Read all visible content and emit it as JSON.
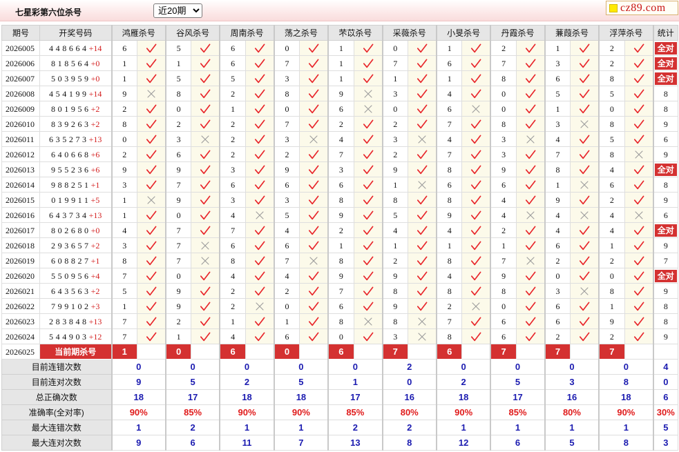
{
  "header": {
    "title": "七星彩第六位杀号",
    "period_selected": "近20期",
    "logo_text": "cz89.com"
  },
  "colors": {
    "accent_red": "#d43131",
    "check_red": "#e8262b",
    "cross_gray": "#9c9c9c",
    "value_blue": "#1b1bb0",
    "header_gray": "#e6e6e6"
  },
  "table": {
    "columns": {
      "issue": "期号",
      "draw": "开奖号码",
      "killers": [
        "鸿雁杀号",
        "谷风杀号",
        "周南杀号",
        "荡之杀号",
        "芣苡杀号",
        "采薇杀号",
        "小旻杀号",
        "丹霞杀号",
        "蒹葭杀号",
        "浮萍杀号"
      ],
      "stat": "统计"
    },
    "rows": [
      {
        "issue": "2026005",
        "draw": "448664",
        "extra": "+14",
        "kills": [
          6,
          5,
          6,
          0,
          1,
          0,
          1,
          2,
          1,
          2
        ],
        "hits": [
          true,
          true,
          true,
          true,
          true,
          true,
          true,
          true,
          true,
          true
        ],
        "stat": "全对"
      },
      {
        "issue": "2026006",
        "draw": "818564",
        "extra": "+0",
        "kills": [
          1,
          1,
          6,
          7,
          1,
          7,
          6,
          7,
          3,
          2
        ],
        "hits": [
          true,
          true,
          true,
          true,
          true,
          true,
          true,
          true,
          true,
          true
        ],
        "stat": "全对"
      },
      {
        "issue": "2026007",
        "draw": "503959",
        "extra": "+0",
        "kills": [
          1,
          5,
          5,
          3,
          1,
          1,
          1,
          8,
          6,
          8
        ],
        "hits": [
          true,
          true,
          true,
          true,
          true,
          true,
          true,
          true,
          true,
          true
        ],
        "stat": "全对"
      },
      {
        "issue": "2026008",
        "draw": "454199",
        "extra": "+14",
        "kills": [
          9,
          8,
          2,
          8,
          9,
          3,
          4,
          0,
          5,
          5
        ],
        "hits": [
          false,
          true,
          true,
          true,
          false,
          true,
          true,
          true,
          true,
          true
        ],
        "stat": "8"
      },
      {
        "issue": "2026009",
        "draw": "801956",
        "extra": "+2",
        "kills": [
          2,
          0,
          1,
          0,
          6,
          0,
          6,
          0,
          1,
          0
        ],
        "hits": [
          true,
          true,
          true,
          true,
          false,
          true,
          false,
          true,
          true,
          true
        ],
        "stat": "8"
      },
      {
        "issue": "2026010",
        "draw": "839263",
        "extra": "+2",
        "kills": [
          8,
          2,
          2,
          7,
          2,
          2,
          7,
          8,
          3,
          8
        ],
        "hits": [
          true,
          true,
          true,
          true,
          true,
          true,
          true,
          true,
          false,
          true
        ],
        "stat": "9"
      },
      {
        "issue": "2026011",
        "draw": "635273",
        "extra": "+13",
        "kills": [
          0,
          3,
          2,
          3,
          4,
          3,
          4,
          3,
          4,
          5
        ],
        "hits": [
          true,
          false,
          true,
          false,
          true,
          false,
          true,
          false,
          true,
          true
        ],
        "stat": "6"
      },
      {
        "issue": "2026012",
        "draw": "640668",
        "extra": "+6",
        "kills": [
          2,
          6,
          2,
          2,
          7,
          2,
          7,
          3,
          7,
          8
        ],
        "hits": [
          true,
          true,
          true,
          true,
          true,
          true,
          true,
          true,
          true,
          false
        ],
        "stat": "9"
      },
      {
        "issue": "2026013",
        "draw": "955236",
        "extra": "+6",
        "kills": [
          9,
          9,
          3,
          9,
          3,
          9,
          8,
          9,
          8,
          4
        ],
        "hits": [
          true,
          true,
          true,
          true,
          true,
          true,
          true,
          true,
          true,
          true
        ],
        "stat": "全对"
      },
      {
        "issue": "2026014",
        "draw": "988251",
        "extra": "+1",
        "kills": [
          3,
          7,
          6,
          6,
          6,
          1,
          6,
          6,
          1,
          6
        ],
        "hits": [
          true,
          true,
          true,
          true,
          true,
          false,
          true,
          true,
          false,
          true
        ],
        "stat": "8"
      },
      {
        "issue": "2026015",
        "draw": "019911",
        "extra": "+5",
        "kills": [
          1,
          9,
          3,
          3,
          8,
          8,
          8,
          4,
          9,
          2
        ],
        "hits": [
          false,
          true,
          true,
          true,
          true,
          true,
          true,
          true,
          true,
          true
        ],
        "stat": "9"
      },
      {
        "issue": "2026016",
        "draw": "643734",
        "extra": "+13",
        "kills": [
          1,
          0,
          4,
          5,
          9,
          5,
          9,
          4,
          4,
          4
        ],
        "hits": [
          true,
          true,
          false,
          true,
          true,
          true,
          true,
          false,
          false,
          false
        ],
        "stat": "6"
      },
      {
        "issue": "2026017",
        "draw": "802680",
        "extra": "+0",
        "kills": [
          4,
          7,
          7,
          4,
          2,
          4,
          4,
          2,
          4,
          4
        ],
        "hits": [
          true,
          true,
          true,
          true,
          true,
          true,
          true,
          true,
          true,
          true
        ],
        "stat": "全对"
      },
      {
        "issue": "2026018",
        "draw": "293657",
        "extra": "+2",
        "kills": [
          3,
          7,
          6,
          6,
          1,
          1,
          1,
          1,
          6,
          1
        ],
        "hits": [
          true,
          false,
          true,
          true,
          true,
          true,
          true,
          true,
          true,
          true
        ],
        "stat": "9"
      },
      {
        "issue": "2026019",
        "draw": "608827",
        "extra": "+1",
        "kills": [
          8,
          7,
          8,
          7,
          8,
          2,
          8,
          7,
          2,
          2
        ],
        "hits": [
          true,
          false,
          true,
          false,
          true,
          true,
          true,
          false,
          true,
          true
        ],
        "stat": "7"
      },
      {
        "issue": "2026020",
        "draw": "550956",
        "extra": "+4",
        "kills": [
          7,
          0,
          4,
          4,
          9,
          9,
          4,
          9,
          0,
          0
        ],
        "hits": [
          true,
          true,
          true,
          true,
          true,
          true,
          true,
          true,
          true,
          true
        ],
        "stat": "全对"
      },
      {
        "issue": "2026021",
        "draw": "643563",
        "extra": "+2",
        "kills": [
          5,
          9,
          2,
          2,
          7,
          8,
          8,
          8,
          3,
          8
        ],
        "hits": [
          true,
          true,
          true,
          true,
          true,
          true,
          true,
          true,
          false,
          true
        ],
        "stat": "9"
      },
      {
        "issue": "2026022",
        "draw": "799102",
        "extra": "+3",
        "kills": [
          1,
          9,
          2,
          0,
          6,
          9,
          2,
          0,
          6,
          1
        ],
        "hits": [
          true,
          true,
          false,
          true,
          true,
          true,
          false,
          true,
          true,
          true
        ],
        "stat": "8"
      },
      {
        "issue": "2026023",
        "draw": "283848",
        "extra": "+13",
        "kills": [
          7,
          2,
          1,
          1,
          8,
          8,
          7,
          6,
          6,
          9
        ],
        "hits": [
          true,
          true,
          true,
          true,
          false,
          false,
          true,
          true,
          true,
          true
        ],
        "stat": "8"
      },
      {
        "issue": "2026024",
        "draw": "544903",
        "extra": "+12",
        "kills": [
          7,
          1,
          4,
          6,
          0,
          3,
          8,
          6,
          2,
          2
        ],
        "hits": [
          true,
          true,
          true,
          true,
          true,
          false,
          true,
          true,
          true,
          true
        ],
        "stat": "9"
      }
    ],
    "current": {
      "issue": "2026025",
      "label": "当前期杀号",
      "kills": [
        1,
        0,
        6,
        0,
        6,
        7,
        6,
        7,
        7,
        7
      ]
    },
    "summary": [
      {
        "label": "目前连错次数",
        "values": [
          0,
          0,
          0,
          0,
          0,
          2,
          0,
          0,
          0,
          0
        ],
        "stat": 4
      },
      {
        "label": "目前连对次数",
        "values": [
          9,
          5,
          2,
          5,
          1,
          0,
          2,
          5,
          3,
          8
        ],
        "stat": 0
      },
      {
        "label": "总正确次数",
        "values": [
          18,
          17,
          18,
          18,
          17,
          16,
          18,
          17,
          16,
          18
        ],
        "stat": 6
      },
      {
        "label": "准确率(全对率)",
        "values": [
          "90%",
          "85%",
          "90%",
          "90%",
          "85%",
          "80%",
          "90%",
          "85%",
          "80%",
          "90%"
        ],
        "stat": "30%"
      },
      {
        "label": "最大连错次数",
        "values": [
          1,
          2,
          1,
          1,
          2,
          2,
          1,
          1,
          1,
          1
        ],
        "stat": 5
      },
      {
        "label": "最大连对次数",
        "values": [
          9,
          6,
          11,
          7,
          13,
          8,
          12,
          6,
          5,
          8
        ],
        "stat": 3
      }
    ]
  }
}
